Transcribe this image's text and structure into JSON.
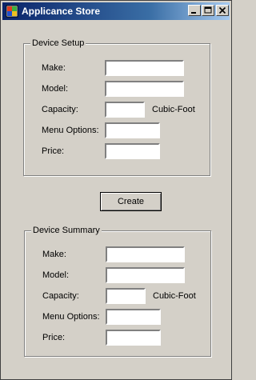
{
  "window": {
    "title": "Applicance Store"
  },
  "caption_buttons": {
    "minimize": "minimize-icon",
    "maximize": "maximize-icon",
    "close": "close-icon"
  },
  "setup": {
    "legend": "Device Setup",
    "make_label": "Make:",
    "make_value": "",
    "model_label": "Model:",
    "model_value": "",
    "capacity_label": "Capacity:",
    "capacity_value": "",
    "capacity_unit": "Cubic-Foot",
    "menu_label": "Menu Options:",
    "menu_value": "",
    "price_label": "Price:",
    "price_value": ""
  },
  "create_button": "Create",
  "summary": {
    "legend": "Device Summary",
    "make_label": "Make:",
    "make_value": "",
    "model_label": "Model:",
    "model_value": "",
    "capacity_label": "Capacity:",
    "capacity_value": "",
    "capacity_unit": "Cubic-Foot",
    "menu_label": "Menu Options:",
    "menu_value": "",
    "price_label": "Price:",
    "price_value": ""
  }
}
